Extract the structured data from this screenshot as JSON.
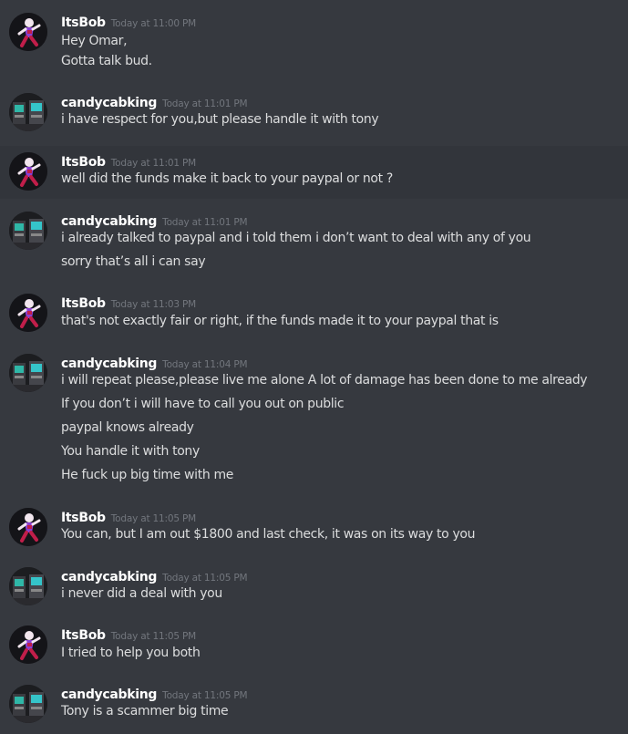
{
  "users": {
    "itsbob": {
      "name": "ItsBob",
      "avatar_icon": "purple-runner-avatar"
    },
    "candy": {
      "name": "candycabking",
      "avatar_icon": "arcade-cabinets-avatar"
    }
  },
  "messages": [
    {
      "author": "ItsBob",
      "time": "Today at 11:00 PM",
      "lines": [
        "Hey Omar,",
        "Gotta talk bud."
      ]
    },
    {
      "author": "candycabking",
      "time": "Today at 11:01 PM",
      "lines": [
        "i have respect for you,but please handle it with tony"
      ]
    },
    {
      "author": "ItsBob",
      "time": "Today at 11:01 PM",
      "lines": [
        "well did the funds make it back to your paypal or not ?"
      ]
    },
    {
      "author": "candycabking",
      "time": "Today at 11:01 PM",
      "lines": [
        "i already talked to paypal and i told them i don’t want to deal with any of you",
        "sorry that’s all i can say"
      ]
    },
    {
      "author": "ItsBob",
      "time": "Today at 11:03 PM",
      "lines": [
        "that's not exactly fair or right, if the funds made it to your paypal that is"
      ]
    },
    {
      "author": "candycabking",
      "time": "Today at 11:04 PM",
      "lines": [
        "i will repeat please,please live me alone  A lot of damage has been done to me already",
        "If you don’t i will have to call you out on public",
        "paypal knows already",
        "You handle it with tony",
        "He fuck up big time with me"
      ]
    },
    {
      "author": "ItsBob",
      "time": "Today at 11:05 PM",
      "lines": [
        "You can, but I am out $1800 and last check, it was on its way to you"
      ]
    },
    {
      "author": "candycabking",
      "time": "Today at 11:05 PM",
      "lines": [
        "i never did a deal with you"
      ]
    },
    {
      "author": "ItsBob",
      "time": "Today at 11:05 PM",
      "lines": [
        "I tried to help you both"
      ]
    },
    {
      "author": "candycabking",
      "time": "Today at 11:05 PM",
      "lines": [
        "Tony is a scammer big time"
      ]
    }
  ]
}
